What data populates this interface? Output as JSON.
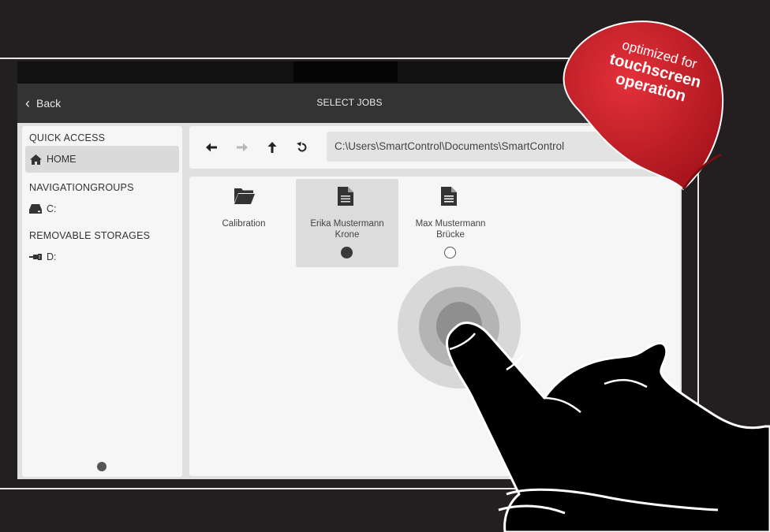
{
  "header": {
    "back_label": "Back",
    "title": "SELECT JOBS"
  },
  "sidebar": {
    "sections": [
      {
        "heading": "QUICK ACCESS",
        "items": [
          {
            "label": "HOME",
            "icon": "home-icon",
            "selected": true
          }
        ]
      },
      {
        "heading": "NAVIGATIONGROUPS",
        "items": [
          {
            "label": "C:",
            "icon": "hard-drive-icon",
            "selected": false
          }
        ]
      },
      {
        "heading": "REMOVABLE STORAGES",
        "items": [
          {
            "label": "D:",
            "icon": "usb-icon",
            "selected": false
          }
        ]
      }
    ]
  },
  "toolbar": {
    "buttons": [
      {
        "name": "back-arrow-icon",
        "enabled": true
      },
      {
        "name": "forward-arrow-icon",
        "enabled": false
      },
      {
        "name": "up-arrow-icon",
        "enabled": true
      },
      {
        "name": "refresh-icon",
        "enabled": true
      }
    ],
    "path": "C:\\Users\\SmartControl\\Documents\\SmartControl"
  },
  "files": [
    {
      "type": "folder",
      "icon": "folder-icon",
      "line1": "Calibration",
      "line2": "",
      "radio": null,
      "selected": false
    },
    {
      "type": "file",
      "icon": "document-icon",
      "line1": "Erika Mustermann",
      "line2": "Krone",
      "radio": "checked",
      "selected": true
    },
    {
      "type": "file",
      "icon": "document-icon",
      "line1": "Max Mustermann",
      "line2": "Brücke",
      "radio": "unchecked",
      "selected": false
    }
  ],
  "badge": {
    "line1": "optimized for",
    "line2": "touchscreen",
    "line3": "operation",
    "color": "#c8202b"
  },
  "colors": {
    "background": "#231f20",
    "appbar": "#333333",
    "panel": "#f6f6f6",
    "selection": "#dcdcdc"
  }
}
